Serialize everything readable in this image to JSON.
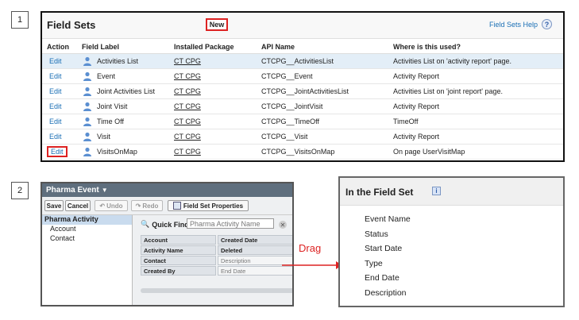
{
  "steps": [
    "1",
    "2"
  ],
  "field_sets": {
    "title": "Field Sets",
    "new_button": "New",
    "help_link": "Field Sets Help",
    "help_icon": "?",
    "columns": [
      "Action",
      "Field Label",
      "Installed Package",
      "API Name",
      "Where is this used?"
    ],
    "rows": [
      {
        "action": "Edit",
        "label": "Activities List",
        "package": "CT CPG",
        "api": "CTCPG__ActivitiesList",
        "where": "Activities List on 'activity report' page."
      },
      {
        "action": "Edit",
        "label": "Event",
        "package": "CT CPG",
        "api": "CTCPG__Event",
        "where": "Activity Report"
      },
      {
        "action": "Edit",
        "label": "Joint Activities List",
        "package": "CT CPG",
        "api": "CTCPG__JointActivitiesList",
        "where": "Activities List on 'joint report' page."
      },
      {
        "action": "Edit",
        "label": "Joint Visit",
        "package": "CT CPG",
        "api": "CTCPG__JointVisit",
        "where": "Activity Report"
      },
      {
        "action": "Edit",
        "label": "Time Off",
        "package": "CT CPG",
        "api": "CTCPG__TimeOff",
        "where": "TimeOff"
      },
      {
        "action": "Edit",
        "label": "Visit",
        "package": "CT CPG",
        "api": "CTCPG__Visit",
        "where": "Activity Report"
      },
      {
        "action": "Edit",
        "label": "VisitsOnMap",
        "package": "CT CPG",
        "api": "CTCPG__VisitsOnMap",
        "where": "On page UserVisitMap"
      }
    ]
  },
  "editor": {
    "title": "Pharma Event",
    "toolbar": {
      "save": "Save",
      "cancel": "Cancel",
      "undo": "Undo",
      "redo": "Redo",
      "properties": "Field Set Properties"
    },
    "sidebar": [
      "Pharma Activity",
      "Account",
      "Contact"
    ],
    "quick_find_label": "Quick Find",
    "quick_find_value": "Pharma Activity Name",
    "fields": [
      "Account",
      "Created Date",
      "Activity Name",
      "Deleted",
      "Contact",
      "Description",
      "Created By",
      "End Date"
    ]
  },
  "drag_label": "Drag",
  "in_field_set": {
    "title": "In the Field Set",
    "info_icon": "i",
    "fields": [
      "Event Name",
      "Status",
      "Start Date",
      "Type",
      "End Date",
      "Description"
    ]
  },
  "colors": {
    "highlight": "#e3eef7",
    "callout": "#dd2222",
    "link": "#1a6fb5"
  }
}
